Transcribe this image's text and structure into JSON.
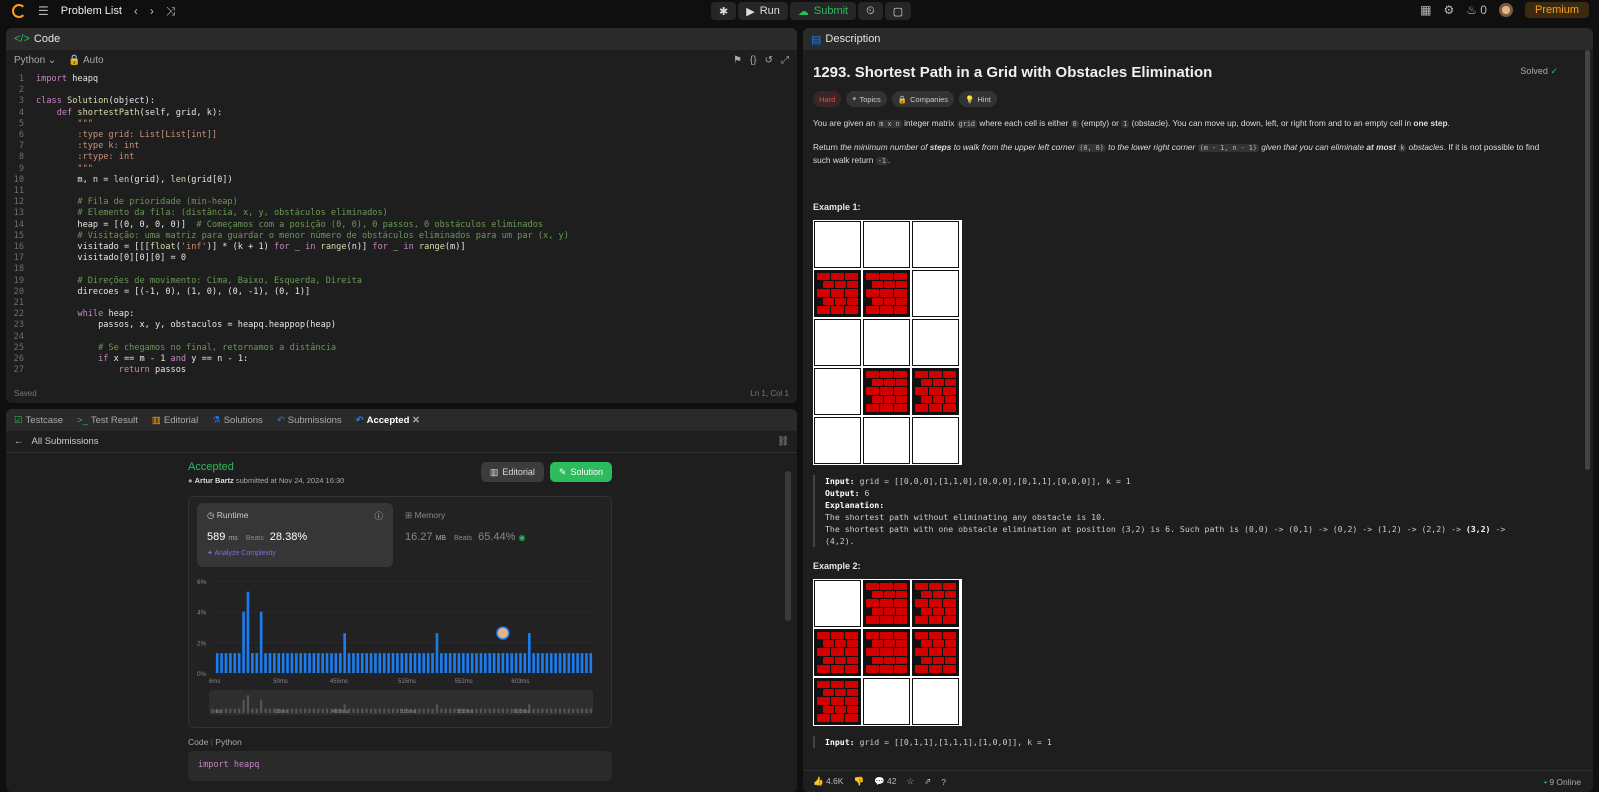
{
  "topbar": {
    "title": "Problem List",
    "run": "Run",
    "submit": "Submit",
    "streak": "0",
    "premium": "Premium"
  },
  "code_panel": {
    "header": "Code",
    "language": "Python",
    "mode": "Auto",
    "status_left": "Saved",
    "status_right": "Ln 1, Col 1"
  },
  "code_lines": [
    [
      "1",
      "import heapq"
    ],
    [
      "2",
      ""
    ],
    [
      "3",
      "class Solution(object):"
    ],
    [
      "4",
      "    def shortestPath(self, grid, k):"
    ],
    [
      "5",
      "        \"\"\""
    ],
    [
      "6",
      "        :type grid: List[List[int]]"
    ],
    [
      "7",
      "        :type k: int"
    ],
    [
      "8",
      "        :rtype: int"
    ],
    [
      "9",
      "        \"\"\""
    ],
    [
      "10",
      "        m, n = len(grid), len(grid[0])"
    ],
    [
      "11",
      ""
    ],
    [
      "12",
      "        # Fila de prioridade (min-heap)"
    ],
    [
      "13",
      "        # Elemento da fila: (distância, x, y, obstáculos eliminados)"
    ],
    [
      "14",
      "        heap = [(0, 0, 0, 0)]  # Começamos com a posição (0, 0), 0 passos, 0 obstáculos eliminados"
    ],
    [
      "15",
      "        # Visitação: uma matriz para guardar o menor número de obstáculos eliminados para um par (x, y)"
    ],
    [
      "16",
      "        visitado = [[[float('inf')] * (k + 1) for _ in range(n)] for _ in range(m)]"
    ],
    [
      "17",
      "        visitado[0][0][0] = 0"
    ],
    [
      "18",
      ""
    ],
    [
      "19",
      "        # Direções de movimento: Cima, Baixo, Esquerda, Direita"
    ],
    [
      "20",
      "        direcoes = [(-1, 0), (1, 0), (0, -1), (0, 1)]"
    ],
    [
      "21",
      ""
    ],
    [
      "22",
      "        while heap:"
    ],
    [
      "23",
      "            passos, x, y, obstaculos = heapq.heappop(heap)"
    ],
    [
      "24",
      ""
    ],
    [
      "25",
      "            # Se chegamos no final, retornamos a distância"
    ],
    [
      "26",
      "            if x == m - 1 and y == n - 1:"
    ],
    [
      "27",
      "                return passos"
    ]
  ],
  "sub_tabs": {
    "testcase": "Testcase",
    "test_result": "Test Result",
    "editorial": "Editorial",
    "solutions": "Solutions",
    "submissions": "Submissions",
    "accepted": "Accepted"
  },
  "submission": {
    "back_label": "All Submissions",
    "status": "Accepted",
    "user": "Artur Bartz",
    "submitted_text": "submitted at Nov 24, 2024 16:30",
    "editorial_btn": "Editorial",
    "solution_btn": "Solution",
    "runtime_label": "Runtime",
    "runtime_value": "589",
    "runtime_unit": "ms",
    "beats_label": "Beats",
    "runtime_beats": "28.38%",
    "analyze": "Analyze Complexity",
    "memory_label": "Memory",
    "memory_value": "16.27",
    "memory_unit": "MB",
    "memory_beats": "65.44%",
    "code_label": "Code",
    "code_lang": "Python",
    "code_first_line": "import heapq"
  },
  "chart_data": {
    "type": "bar",
    "yticks": [
      "6%",
      "4%",
      "2%",
      "0%"
    ],
    "xticks": [
      "6ms",
      "50ms",
      "455ms",
      "515ms",
      "552ms",
      "603ms"
    ],
    "ylim": [
      0,
      6
    ],
    "values": [
      1.3,
      1.3,
      1.3,
      1.3,
      1.3,
      1.3,
      4.0,
      5.3,
      1.3,
      1.3,
      4.0,
      1.3,
      1.3,
      1.3,
      1.3,
      1.3,
      1.3,
      1.3,
      1.3,
      1.3,
      1.3,
      1.3,
      1.3,
      1.3,
      1.3,
      1.3,
      1.3,
      1.3,
      1.3,
      2.6,
      1.3,
      1.3,
      1.3,
      1.3,
      1.3,
      1.3,
      1.3,
      1.3,
      1.3,
      1.3,
      1.3,
      1.3,
      1.3,
      1.3,
      1.3,
      1.3,
      1.3,
      1.3,
      1.3,
      1.3,
      2.6,
      1.3,
      1.3,
      1.3,
      1.3,
      1.3,
      1.3,
      1.3,
      1.3,
      1.3,
      1.3,
      1.3,
      1.3,
      1.3,
      1.3,
      1.3,
      1.3,
      1.3,
      1.3,
      1.3,
      1.3,
      2.6,
      1.3,
      1.3,
      1.3,
      1.3,
      1.3,
      1.3,
      1.3,
      1.3,
      1.3,
      1.3,
      1.3,
      1.3,
      1.3,
      1.3
    ],
    "bar_color": "#1a7cf0",
    "grid": true,
    "marker_index": 65
  },
  "description": {
    "header": "Description",
    "title": "1293. Shortest Path in a Grid with Obstacles Elimination",
    "solved": "Solved",
    "difficulty": "Hard",
    "topics": "Topics",
    "companies": "Companies",
    "hint": "Hint",
    "p1_a": "You are given an",
    "p1_code1": "m x n",
    "p1_b": "integer matrix",
    "p1_code2": "grid",
    "p1_c": "where each cell is either",
    "p1_code3": "0",
    "p1_d": "(empty) or",
    "p1_code4": "1",
    "p1_e": "(obstacle). You can move up, down, left, or right from and to an empty cell in",
    "p1_bold": "one step",
    "p2_a": "Return",
    "p2_i1": "the minimum number of",
    "p2_b1": "steps",
    "p2_i2": "to walk from the upper left corner",
    "p2_code1": "(0, 0)",
    "p2_i3": "to the lower right corner",
    "p2_code2": "(m - 1, n - 1)",
    "p2_i4": "given that you can eliminate",
    "p2_b2": "at most",
    "p2_code3": "k",
    "p2_i5": "obstacles",
    "p2_c": ". If it is not possible to find such walk return",
    "p2_code4": "-1",
    "ex1_title": "Example 1:",
    "ex1_input_label": "Input:",
    "ex1_input": "grid = [[0,0,0],[1,1,0],[0,0,0],[0,1,1],[0,0,0]], k = 1",
    "ex1_output_label": "Output:",
    "ex1_output": "6",
    "ex1_expl_label": "Explanation:",
    "ex1_expl1": "The shortest path without eliminating any obstacle is 10.",
    "ex1_expl2": "The shortest path with one obstacle elimination at position (3,2) is 6. Such path is (0,0) -> (0,1) -> (0,2) -> (1,2) -> (2,2) ->",
    "ex1_expl2_bold": "(3,2)",
    "ex1_expl2_end": "->",
    "ex1_expl3": "(4,2).",
    "ex2_title": "Example 2:",
    "ex2_input_label": "Input:",
    "ex2_input": "grid = [[0,1,1],[1,1,1],[1,0,0]], k = 1"
  },
  "grid1": [
    [
      0,
      0,
      0
    ],
    [
      1,
      1,
      0
    ],
    [
      0,
      0,
      0
    ],
    [
      0,
      1,
      1
    ],
    [
      0,
      0,
      0
    ]
  ],
  "grid2": [
    [
      0,
      1,
      1
    ],
    [
      1,
      1,
      1
    ],
    [
      1,
      0,
      0
    ]
  ],
  "footer": {
    "likes": "4.6K",
    "comments": "42",
    "online": "9 Online"
  }
}
